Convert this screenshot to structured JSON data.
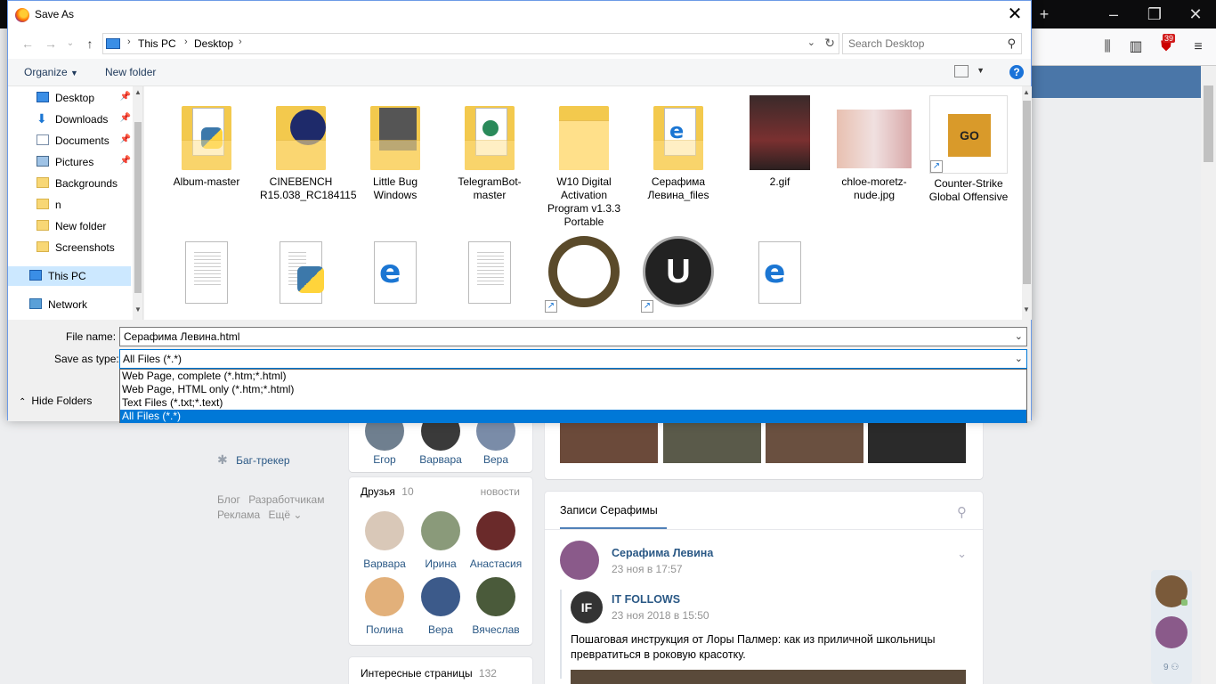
{
  "dialog": {
    "title": "Save As",
    "address": {
      "crumbs": [
        "This PC",
        "Desktop"
      ]
    },
    "search_placeholder": "Search Desktop",
    "toolbar": {
      "organize": "Organize",
      "new_folder": "New folder",
      "help": "?"
    },
    "nav_items": [
      {
        "label": "Desktop",
        "icon": "desktop-icon",
        "pinned": true
      },
      {
        "label": "Downloads",
        "icon": "downloads-icon",
        "pinned": true
      },
      {
        "label": "Documents",
        "icon": "documents-icon",
        "pinned": true
      },
      {
        "label": "Pictures",
        "icon": "pictures-icon",
        "pinned": true
      },
      {
        "label": "Backgrounds",
        "icon": "folder-icon",
        "pinned": false
      },
      {
        "label": "n",
        "icon": "folder-icon",
        "pinned": false
      },
      {
        "label": "New folder",
        "icon": "folder-icon",
        "pinned": false
      },
      {
        "label": "Screenshots",
        "icon": "folder-icon",
        "pinned": false
      },
      {
        "label": "This PC",
        "icon": "this-pc-icon",
        "pinned": false,
        "selected": true
      },
      {
        "label": "Network",
        "icon": "network-icon",
        "pinned": false
      }
    ],
    "files_row1": [
      {
        "name": "Album-master",
        "kind": "folder"
      },
      {
        "name": "CINEBENCH R15.038_RC184115",
        "kind": "folder"
      },
      {
        "name": "Little Bug Windows",
        "kind": "folder"
      },
      {
        "name": "TelegramBot-master",
        "kind": "folder"
      },
      {
        "name": "W10 Digital Activation Program v1.3.3 Portable",
        "kind": "folder"
      },
      {
        "name": "Серафима Левина_files",
        "kind": "folder"
      },
      {
        "name": "2.gif",
        "kind": "image"
      },
      {
        "name": "chloe-moretz-nude.jpg",
        "kind": "image"
      },
      {
        "name": "Counter-Strike Global Offensive",
        "kind": "shortcut"
      }
    ],
    "files_row2": [
      {
        "name": "",
        "kind": "text-doc"
      },
      {
        "name": "",
        "kind": "python-file"
      },
      {
        "name": "",
        "kind": "edge-file"
      },
      {
        "name": "",
        "kind": "text-doc"
      },
      {
        "name": "",
        "kind": "shortcut"
      },
      {
        "name": "",
        "kind": "shortcut"
      },
      {
        "name": "",
        "kind": "edge-file"
      }
    ],
    "file_name_label": "File name:",
    "file_name_value": "Серафима Левина.html",
    "save_type_label": "Save as type:",
    "save_type_value": "All Files (*.*)",
    "save_type_options": [
      "Web Page, complete (*.htm;*.html)",
      "Web Page, HTML only (*.htm;*.html)",
      "Text Files (*.txt;*.text)",
      "All Files (*.*)"
    ],
    "save_type_selected_index": 3,
    "hide_folders": "Hide Folders"
  },
  "browser": {
    "notification_count": "39"
  },
  "vk": {
    "side_links": {
      "bugtracker": "Баг-трекер",
      "blog": "Блог",
      "developers": "Разработчикам",
      "ads": "Реклама",
      "more": "Ещё"
    },
    "friends_top_names": [
      "Егор",
      "Варвара",
      "Вера"
    ],
    "friends": {
      "title": "Друзья",
      "count": "10",
      "link": "новости",
      "names": [
        "Варвара",
        "Ирина",
        "Анастасия",
        "Полина",
        "Вера",
        "Вячеслав"
      ]
    },
    "interesting": {
      "title": "Интересные страницы",
      "count": "132"
    },
    "wall": {
      "title": "Записи Серафимы"
    },
    "post": {
      "author": "Серафима Левина",
      "date": "23 ноя в 17:57",
      "repost_author": "IT FOLLOWS",
      "repost_date": "23 ноя 2018 в 15:50",
      "text": "Пошаговая инструкция от Лоры Палмер: как из приличной школьницы превратиться в роковую красотку."
    },
    "online_count": "9"
  }
}
